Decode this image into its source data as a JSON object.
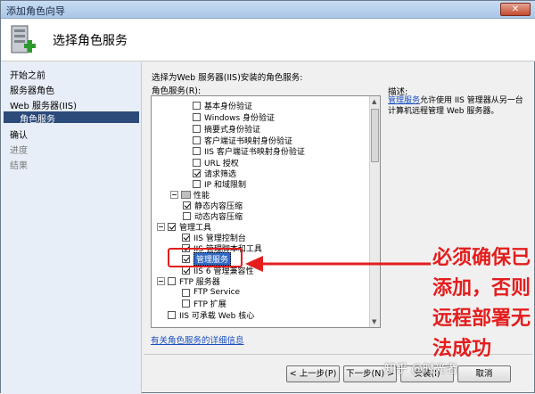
{
  "window": {
    "title": "添加角色向导",
    "close_label": "✕"
  },
  "header": {
    "heading": "选择角色服务"
  },
  "sidebar": {
    "items": [
      {
        "label": "开始之前"
      },
      {
        "label": "服务器角色"
      },
      {
        "label": "Web 服务器(IIS)"
      },
      {
        "label": "角色服务"
      },
      {
        "label": "确认"
      },
      {
        "label": "进度"
      },
      {
        "label": "结果"
      }
    ]
  },
  "main": {
    "instruction_line1": "选择为Web 服务器(IIS)安装的角色服务:",
    "instruction_line2": "角色服务(R):",
    "tree": [
      {
        "label": "基本身份验证",
        "checked": false
      },
      {
        "label": "Windows 身份验证",
        "checked": false
      },
      {
        "label": "摘要式身份验证",
        "checked": false
      },
      {
        "label": "客户端证书映射身份验证",
        "checked": false
      },
      {
        "label": "IIS 客户端证书映射身份验证",
        "checked": false
      },
      {
        "label": "URL 授权",
        "checked": false
      },
      {
        "label": "请求筛选",
        "checked": true
      },
      {
        "label": "IP 和域限制",
        "checked": false
      },
      {
        "label": "性能",
        "checked": false
      },
      {
        "label": "静态内容压缩",
        "checked": true
      },
      {
        "label": "动态内容压缩",
        "checked": false
      },
      {
        "label": "管理工具",
        "checked": true
      },
      {
        "label": "IIS 管理控制台",
        "checked": true
      },
      {
        "label": "IIS 管理脚本和工具",
        "checked": true
      },
      {
        "label": "管理服务",
        "checked": true
      },
      {
        "label": "IIS 6 管理兼容性",
        "checked": true
      },
      {
        "label": "FTP 服务器",
        "checked": false
      },
      {
        "label": "FTP Service",
        "checked": false
      },
      {
        "label": "FTP 扩展",
        "checked": false
      },
      {
        "label": "IIS 可承载 Web 核心",
        "checked": false
      }
    ],
    "more_info_link": "有关角色服务的详细信息"
  },
  "description": {
    "label": "描述:",
    "link_text": "管理服务",
    "text": "允许使用 IIS 管理器从另一台计算机远程管理 Web 服务器。"
  },
  "buttons": {
    "prev": "< 上一步(P)",
    "next": "下一步(N) >",
    "install": "安装(I)",
    "cancel": "取消"
  },
  "annotation": {
    "text": "必须确保已添加，否则远程部署无法成功"
  },
  "watermark": {
    "text": "知乎 @时光者"
  },
  "colors": {
    "sidebar_selected": "#2c4a7a",
    "annotation_red": "#e41d1d",
    "link_blue": "#1a4fbf"
  }
}
